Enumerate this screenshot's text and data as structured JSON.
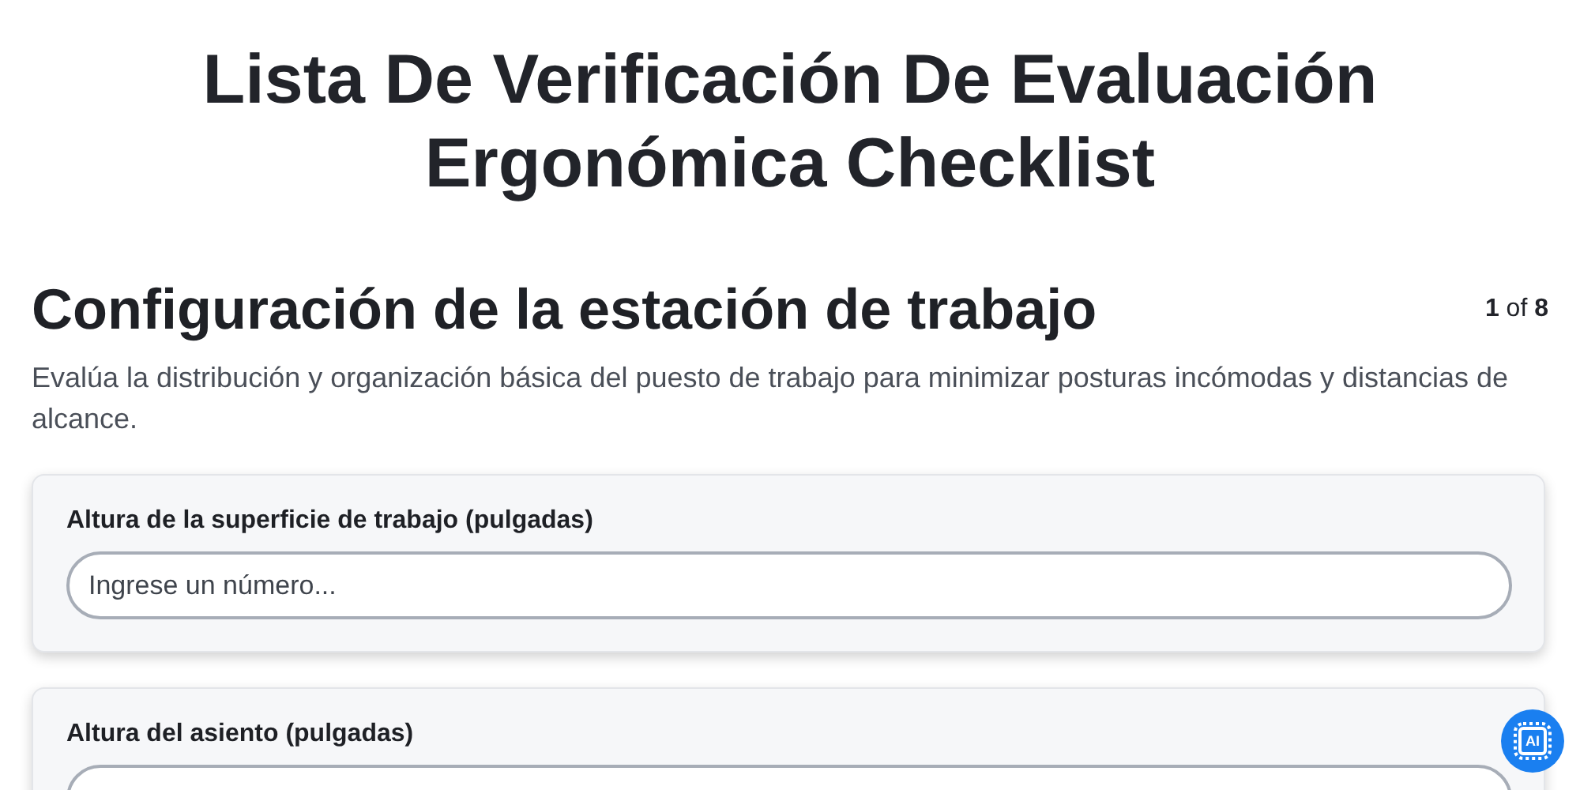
{
  "title": "Lista De Verificación De Evaluación Ergonómica Checklist",
  "section": {
    "heading": "Configuración de la estación de trabajo",
    "step": "1",
    "step_sep": "of",
    "step_total": "8",
    "description": "Evalúa la distribución y organización básica del puesto de trabajo para minimizar posturas incómodas y distancias de alcance."
  },
  "questions": [
    {
      "label": "Altura de la superficie de trabajo (pulgadas)",
      "placeholder": "Ingrese un número..."
    },
    {
      "label": "Altura del asiento (pulgadas)"
    }
  ],
  "ai_button": {
    "label": "AI"
  }
}
